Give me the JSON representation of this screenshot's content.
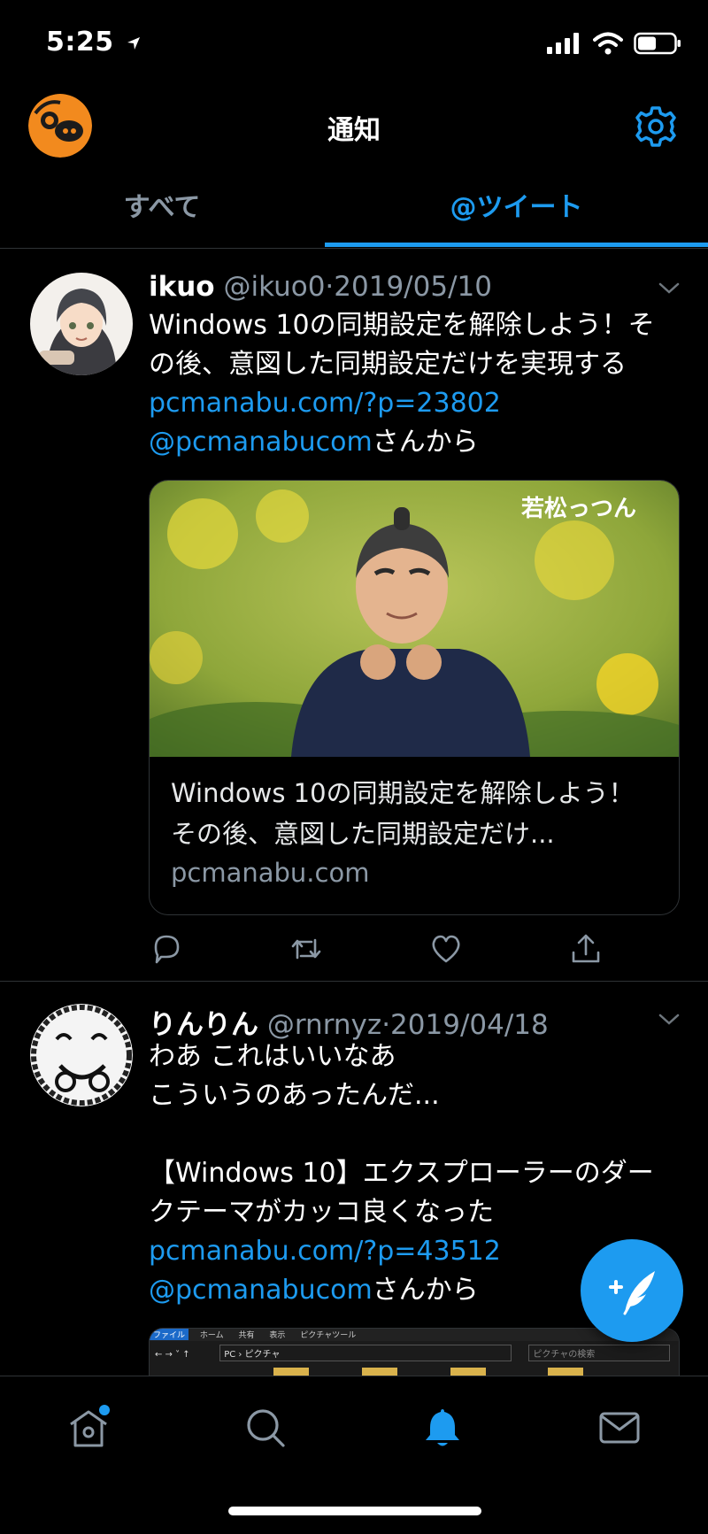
{
  "status_bar": {
    "time": "5:25"
  },
  "header": {
    "title": "通知"
  },
  "tabs": [
    {
      "label": "すべて"
    },
    {
      "label": "@ツイート"
    }
  ],
  "tweets": [
    {
      "name": "ikuo",
      "handle": "@ikuo0",
      "date": "2019/05/10",
      "text_1": "Windows 10の同期設定を解除しよう！その後、意図した同期設定だけを実現する ",
      "link": "pcmanabu.com/?p=23802",
      "mention": "@pcmanabucom",
      "suffix": "さんから",
      "card": {
        "title": "Windows 10の同期設定を解除しよう！その後、意図した同期設定だけ...",
        "domain": "pcmanabu.com",
        "image_caption": "若松っつん"
      }
    },
    {
      "name": "りんりん",
      "handle": "@rnrnyz",
      "date": "2019/04/18",
      "text_1": "わあ これはいいなあ\nこういうのあったんだ...\n\n【Windows 10】エクスプローラーのダークテーマがカッコ良くなった\n",
      "link": "pcmanabu.com/?p=43512",
      "mention": "@pcmanabucom",
      "suffix": "さんから",
      "preview": {
        "ribbon": [
          "ファイル",
          "ホーム",
          "共有",
          "表示",
          "ピクチャツール"
        ],
        "path": "PC › ピクチャ",
        "search_placeholder": "ピクチャの検索"
      }
    }
  ],
  "colors": {
    "accent": "#1d9bf0",
    "background": "#000000",
    "secondary_text": "#8b98a5",
    "divider": "#2f3336"
  },
  "icons": {
    "header": [
      "profile-avatar",
      "gear-icon"
    ],
    "tweet_actions": [
      "reply-icon",
      "retweet-icon",
      "like-icon",
      "share-icon"
    ],
    "nav": [
      "home-icon",
      "search-icon",
      "bell-icon",
      "mail-icon"
    ],
    "fab": "compose-icon"
  }
}
